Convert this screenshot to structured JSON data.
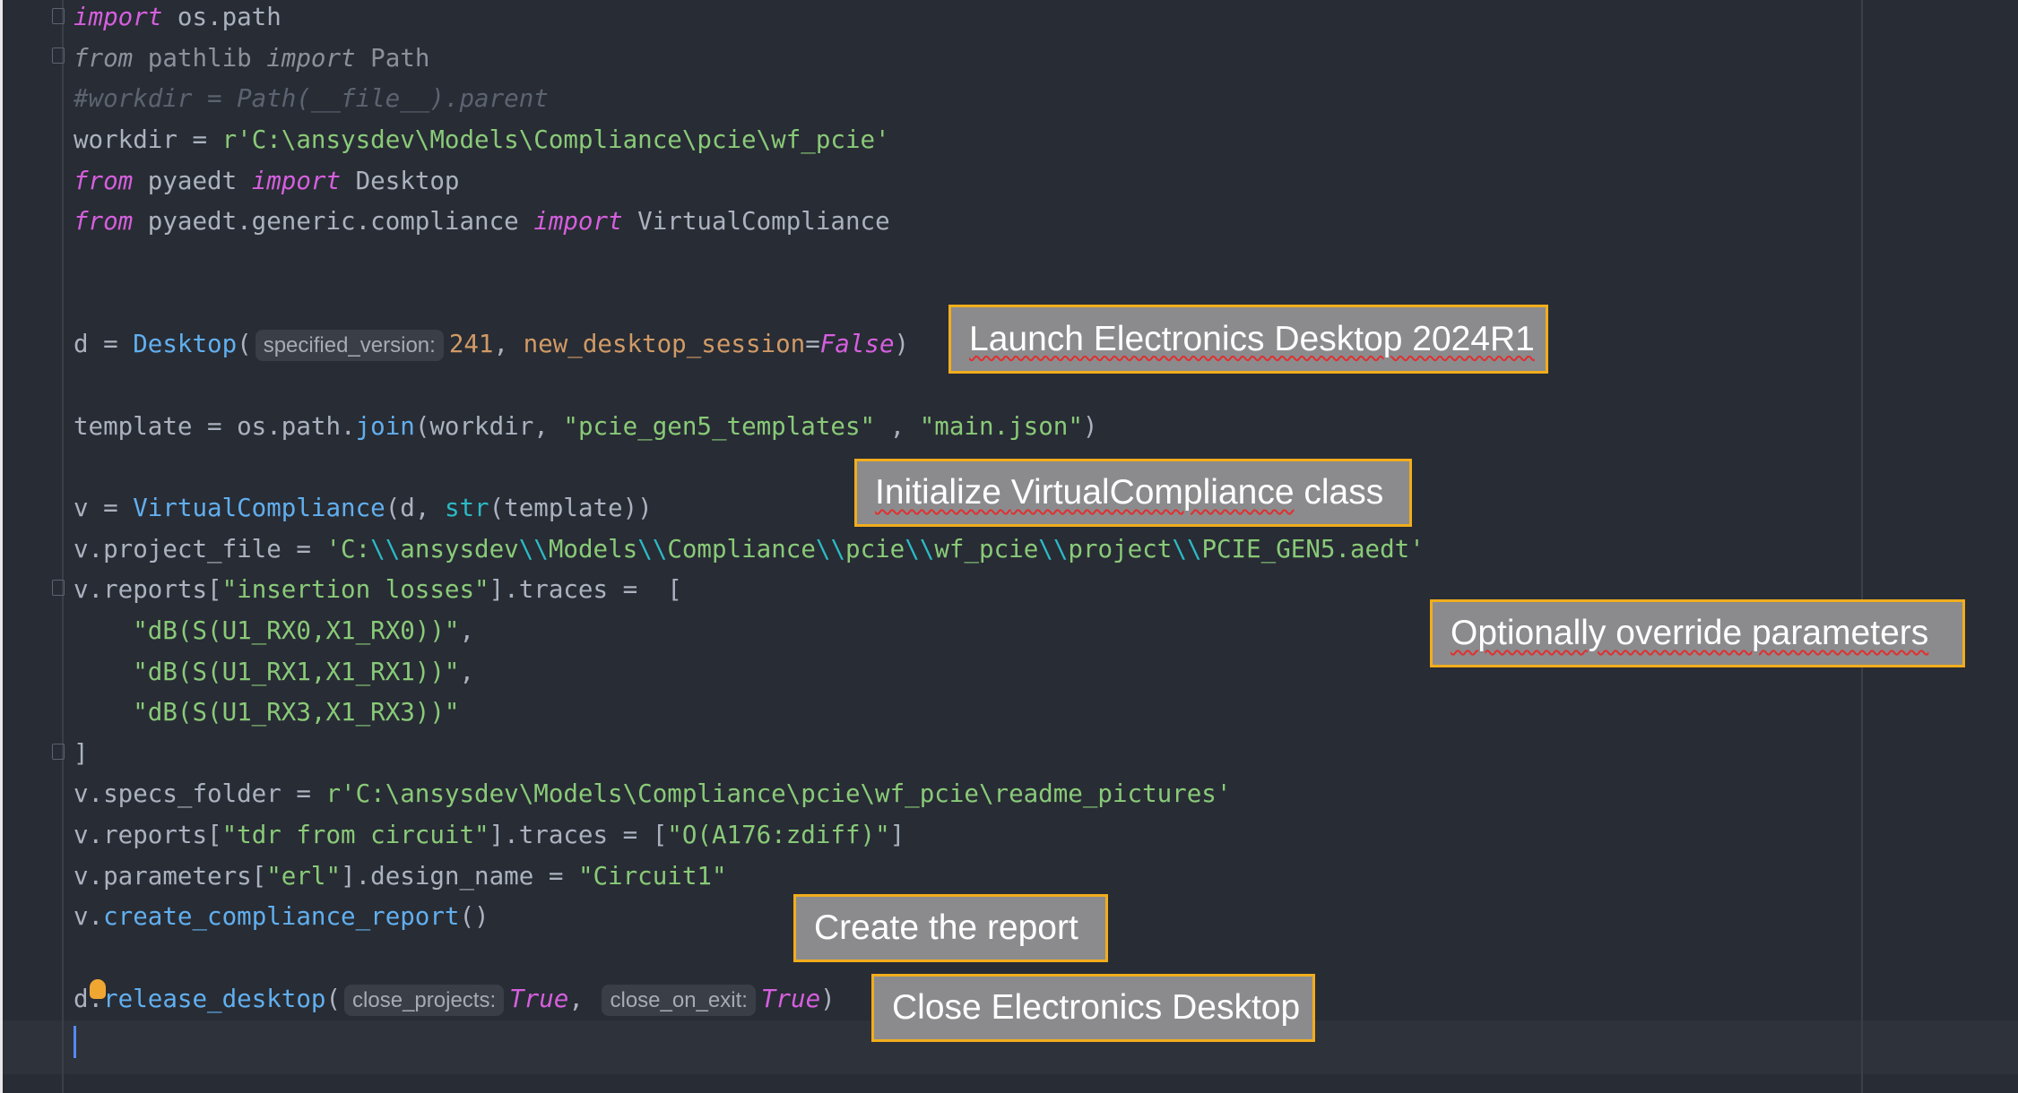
{
  "editor": {
    "lines": [
      [
        [
          "kw",
          "import"
        ],
        [
          "t",
          " os.path"
        ]
      ],
      [
        [
          "dimkw",
          "from"
        ],
        [
          "dim",
          " pathlib "
        ],
        [
          "dimkw",
          "import"
        ],
        [
          "dim",
          " Path"
        ]
      ],
      [
        [
          "cmt",
          "#workdir = Path(__file__).parent"
        ]
      ],
      [
        [
          "t",
          "workdir = "
        ],
        [
          "str",
          "r'C:\\ansysdev\\Models\\Compliance\\pcie\\wf_pcie'"
        ]
      ],
      [
        [
          "kw",
          "from"
        ],
        [
          "t",
          " pyaedt "
        ],
        [
          "kw",
          "import"
        ],
        [
          "t",
          " Desktop"
        ]
      ],
      [
        [
          "kw",
          "from"
        ],
        [
          "t",
          " pyaedt.generic.compliance "
        ],
        [
          "kw",
          "import"
        ],
        [
          "t",
          " VirtualCompliance"
        ]
      ],
      [],
      [],
      [
        [
          "t",
          "d = "
        ],
        [
          "fn",
          "Desktop"
        ],
        [
          "t",
          "("
        ],
        [
          "hint",
          "specified_version:"
        ],
        [
          "num",
          "241"
        ],
        [
          "t",
          ", "
        ],
        [
          "param",
          "new_desktop_session"
        ],
        [
          "t",
          "="
        ],
        [
          "kw",
          "False"
        ],
        [
          "t",
          ")"
        ]
      ],
      [],
      [
        [
          "t",
          "template = os.path."
        ],
        [
          "fn",
          "join"
        ],
        [
          "t",
          "(workdir, "
        ],
        [
          "str",
          "\"pcie_gen5_templates\""
        ],
        [
          "t",
          " , "
        ],
        [
          "str",
          "\"main.json\""
        ],
        [
          "t",
          ")"
        ]
      ],
      [],
      [
        [
          "t",
          "v = "
        ],
        [
          "fn",
          "VirtualCompliance"
        ],
        [
          "t",
          "(d, "
        ],
        [
          "builtin",
          "str"
        ],
        [
          "t",
          "(template))"
        ]
      ],
      [
        [
          "t",
          "v.project_file = "
        ],
        [
          "str",
          "'C:"
        ],
        [
          "esc",
          "\\\\"
        ],
        [
          "str",
          "ansysdev"
        ],
        [
          "esc",
          "\\\\"
        ],
        [
          "str",
          "Models"
        ],
        [
          "esc",
          "\\\\"
        ],
        [
          "str",
          "Compliance"
        ],
        [
          "esc",
          "\\\\"
        ],
        [
          "str",
          "pcie"
        ],
        [
          "esc",
          "\\\\"
        ],
        [
          "str",
          "wf_pcie"
        ],
        [
          "esc",
          "\\\\"
        ],
        [
          "str",
          "project"
        ],
        [
          "esc",
          "\\\\"
        ],
        [
          "str",
          "PCIE_GEN5.aedt'"
        ]
      ],
      [
        [
          "t",
          "v.reports["
        ],
        [
          "str",
          "\"insertion losses\""
        ],
        [
          "t",
          "].traces =  ["
        ]
      ],
      [
        [
          "t",
          "    "
        ],
        [
          "str",
          "\"dB(S(U1_RX0,X1_RX0))\""
        ],
        [
          "t",
          ","
        ]
      ],
      [
        [
          "t",
          "    "
        ],
        [
          "str",
          "\"dB(S(U1_RX1,X1_RX1))\""
        ],
        [
          "t",
          ","
        ]
      ],
      [
        [
          "t",
          "    "
        ],
        [
          "str",
          "\"dB(S(U1_RX3,X1_RX3))\""
        ]
      ],
      [
        [
          "t",
          "]"
        ]
      ],
      [
        [
          "t",
          "v.specs_folder = "
        ],
        [
          "str",
          "r'C:\\ansysdev\\Models\\Compliance\\pcie\\wf_pcie\\readme_pictures'"
        ]
      ],
      [
        [
          "t",
          "v.reports["
        ],
        [
          "str",
          "\"tdr from circuit\""
        ],
        [
          "t",
          "].traces = ["
        ],
        [
          "str",
          "\"O(A176:zdiff)\""
        ],
        [
          "t",
          "]"
        ]
      ],
      [
        [
          "t",
          "v.parameters["
        ],
        [
          "str",
          "\"erl\""
        ],
        [
          "t",
          "].design_name = "
        ],
        [
          "str",
          "\"Circuit1\""
        ]
      ],
      [
        [
          "t",
          "v."
        ],
        [
          "fn",
          "create_compliance_report"
        ],
        [
          "t",
          "()"
        ]
      ],
      [],
      [
        [
          "t",
          "d."
        ],
        [
          "fn",
          "release_desktop"
        ],
        [
          "t",
          "("
        ],
        [
          "hint",
          "close_projects:"
        ],
        [
          "kw",
          "True"
        ],
        [
          "t",
          ", "
        ],
        [
          "hint",
          "close_on_exit:"
        ],
        [
          "kw",
          "True"
        ],
        [
          "t",
          ")"
        ]
      ],
      []
    ]
  },
  "annotations": {
    "launch": "Launch Electronics Desktop 2024R1",
    "init_a": "Initialize ",
    "init_b": "VirtualCompliance",
    "init_c": " class",
    "override": "Optionally override parameters",
    "create": "Create the report",
    "close": "Close Electronics Desktop"
  },
  "colors": {
    "accent_border": "#f2ad1c",
    "note_bg": "#8b8b8d",
    "editor_bg": "#282c34",
    "caret": "#568af2"
  }
}
